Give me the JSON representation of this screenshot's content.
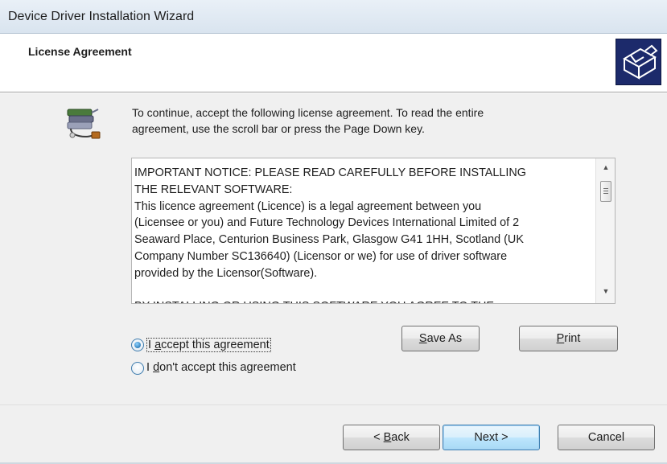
{
  "window": {
    "title": "Device Driver Installation Wizard"
  },
  "header": {
    "heading": "License Agreement",
    "icon": "wizard-setup-icon"
  },
  "body": {
    "device_icon": "device-driver-icon",
    "intro_line1": "To continue, accept the following license agreement. To read the entire",
    "intro_line2": "agreement, use the scroll bar or press the Page Down key.",
    "license_text": "IMPORTANT NOTICE: PLEASE READ CAREFULLY BEFORE INSTALLING\nTHE RELEVANT SOFTWARE:\nThis licence agreement (Licence) is a legal agreement between you\n(Licensee or you) and Future Technology Devices International Limited of 2\nSeaward Place, Centurion Business Park, Glasgow G41 1HH, Scotland (UK\nCompany Number SC136640) (Licensor or we) for use of driver software\nprovided by the Licensor(Software).\n\nBY INSTALLING OR USING THIS SOFTWARE YOU AGREE TO THE",
    "save_as_hotkey": "S",
    "save_as_rest": "ave As",
    "print_hotkey": "P",
    "print_rest": "rint",
    "accept": {
      "prefix": "I ",
      "hotkey": "a",
      "rest": "ccept this agreement",
      "selected": true
    },
    "decline": {
      "prefix": "I ",
      "hotkey": "d",
      "rest": "on't accept this agreement",
      "selected": false
    }
  },
  "footer": {
    "back_prefix": "< ",
    "back_hotkey": "B",
    "back_rest": "ack",
    "next_label": "Next >",
    "cancel_label": "Cancel"
  },
  "colors": {
    "accent": "#3c7fb1",
    "header_icon_bg": "#1c2a6b"
  }
}
